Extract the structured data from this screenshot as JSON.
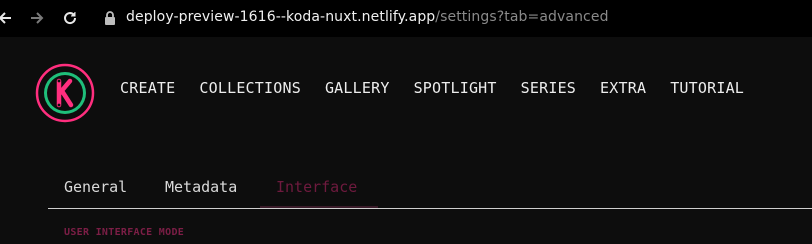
{
  "browser": {
    "url_host": "deploy-preview-1616--koda-nuxt.netlify.app",
    "url_path": "/settings?tab=advanced"
  },
  "header": {
    "logo_letter": "K",
    "menu": [
      "CREATE",
      "COLLECTIONS",
      "GALLERY",
      "SPOTLIGHT",
      "SERIES",
      "EXTRA",
      "TUTORIAL"
    ]
  },
  "tabs": [
    {
      "label": "General"
    },
    {
      "label": "Metadata"
    },
    {
      "label": "Interface",
      "active": true
    }
  ],
  "section": {
    "label": "USER INTERFACE MODE"
  },
  "colors": {
    "background": "#0d0d0d",
    "accent": "#6e1a3e",
    "logo_ring": "#ff2e7e",
    "logo_inner": "#1fbf7a"
  }
}
